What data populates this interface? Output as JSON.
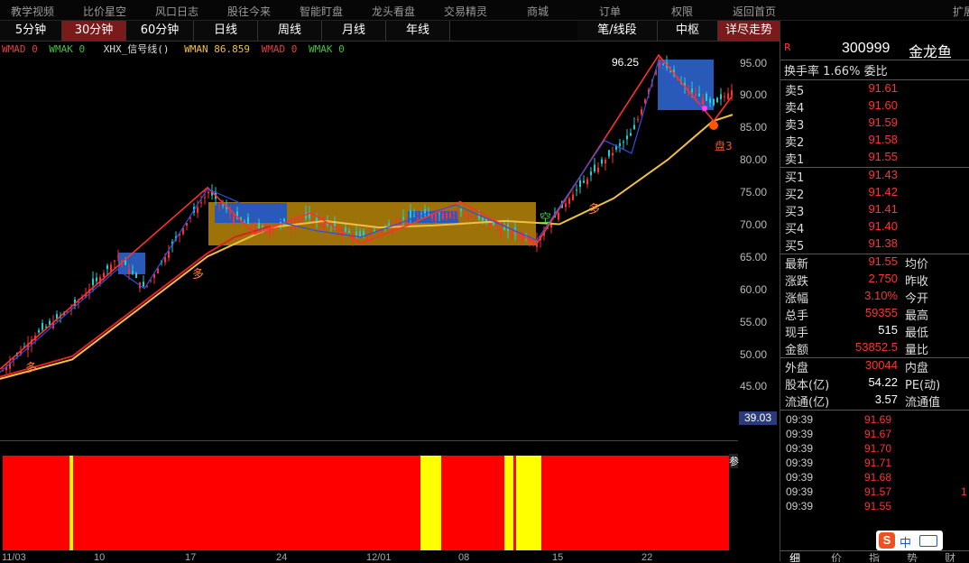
{
  "menu": [
    "教学视频",
    "比价星空",
    "风口日志",
    "股往今来",
    "智能盯盘",
    "龙头看盘",
    "交易精灵",
    "商城",
    "订单",
    "权限",
    "返回首页",
    "扩展"
  ],
  "tabs": [
    "5分钟",
    "30分钟",
    "60分钟",
    "日线",
    "周线",
    "月线",
    "年线",
    "笔/线段",
    "中枢",
    "详尽走势"
  ],
  "active_tab": "30分钟",
  "indicator_line": {
    "a": "WMAD 0",
    "b": "WMAK 0",
    "c": "XHX_信号线()",
    "d": "WMAN 86.859",
    "e": "WMAD 0",
    "f": "WMAK 0"
  },
  "chart_data": {
    "type": "line",
    "yticks": [
      "95.00",
      "90.00",
      "85.00",
      "80.00",
      "75.00",
      "70.00",
      "65.00",
      "60.00",
      "55.00",
      "50.00",
      "45.00"
    ],
    "ylim": [
      40,
      98
    ],
    "peak_label": "96.25",
    "low_axis_label": "39.03",
    "annotations": [
      "多",
      "多",
      "多",
      "空",
      "盘3"
    ],
    "xlabels": [
      "11/03",
      "10",
      "17",
      "24",
      "12/01",
      "08",
      "15",
      "22"
    ],
    "sub_panel_label": "参"
  },
  "quote": {
    "code": "300999",
    "name": "金龙鱼",
    "r_mark": "R",
    "turnover": "换手率 1.66% 委比",
    "sells": [
      [
        "卖5",
        "91.61"
      ],
      [
        "卖4",
        "91.60"
      ],
      [
        "卖3",
        "91.59"
      ],
      [
        "卖2",
        "91.58"
      ],
      [
        "卖1",
        "91.55"
      ]
    ],
    "buys": [
      [
        "买1",
        "91.43"
      ],
      [
        "买2",
        "91.42"
      ],
      [
        "买3",
        "91.41"
      ],
      [
        "买4",
        "91.40"
      ],
      [
        "买5",
        "91.38"
      ]
    ],
    "stats": [
      [
        "最新",
        "91.55",
        "均价"
      ],
      [
        "涨跌",
        "2.750",
        "昨收"
      ],
      [
        "涨幅",
        "3.10%",
        "今开"
      ],
      [
        "总手",
        "59355",
        "最高"
      ],
      [
        "现手",
        "515",
        "最低"
      ],
      [
        "金额",
        "53852.5",
        "量比"
      ]
    ],
    "stats2": [
      [
        "外盘",
        "30044",
        "内盘"
      ],
      [
        "股本(亿)",
        "54.22",
        "PE(动)"
      ],
      [
        "流通(亿)",
        "3.57",
        "流通值"
      ]
    ],
    "ticks": [
      [
        "09:39",
        "91.69"
      ],
      [
        "09:39",
        "91.67"
      ],
      [
        "09:39",
        "91.70"
      ],
      [
        "09:39",
        "91.71"
      ],
      [
        "09:39",
        "91.68"
      ],
      [
        "09:39",
        "91.57"
      ],
      [
        "09:39",
        "91.55"
      ]
    ],
    "tick_extra": "1",
    "bottom_tabs": [
      "细",
      "价",
      "指",
      "势",
      "财"
    ],
    "ime": "中"
  },
  "colors": {
    "up": "#ff3333",
    "ma": "#f0c040",
    "box_blue": "#2a5ab8",
    "box_orange": "#b8860b",
    "sub_red": "#ff0000",
    "sub_yellow": "#ffff00"
  }
}
